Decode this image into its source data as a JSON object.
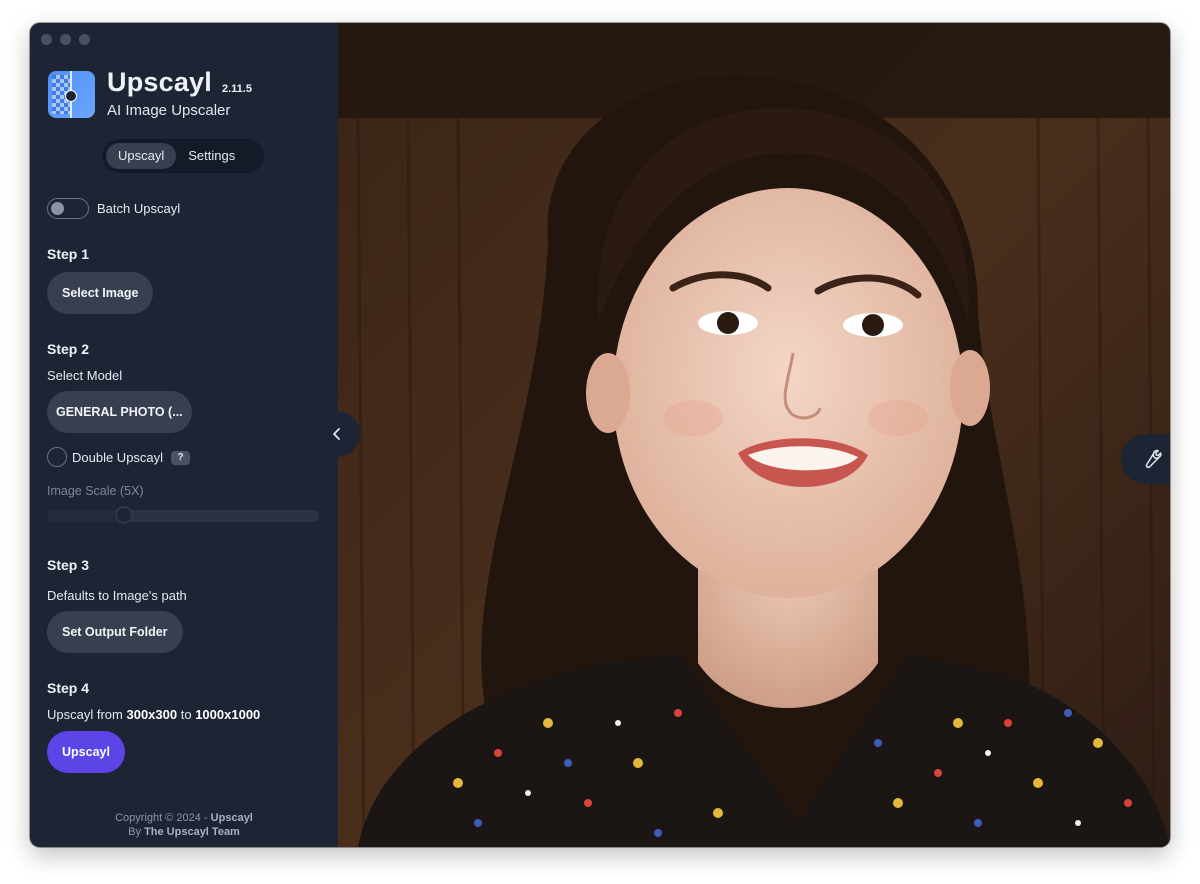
{
  "app": {
    "name": "Upscayl",
    "version": "2.11.5",
    "subtitle": "AI Image Upscaler"
  },
  "tabs": [
    {
      "label": "Upscayl",
      "active": true
    },
    {
      "label": "Settings",
      "active": false
    }
  ],
  "batch": {
    "label": "Batch Upscayl",
    "enabled": false
  },
  "step1": {
    "title": "Step 1",
    "button": "Select Image"
  },
  "step2": {
    "title": "Step 2",
    "select_model_label": "Select Model",
    "model_button": "GENERAL PHOTO (...",
    "double_upscayl_label": "Double Upscayl",
    "double_upscayl_checked": false,
    "help_badge": "?",
    "image_scale_label": "Image Scale (5X)",
    "image_scale_value": 5
  },
  "step3": {
    "title": "Step 3",
    "text": "Defaults to Image's path",
    "button": "Set Output Folder"
  },
  "step4": {
    "title": "Step 4",
    "text_prefix": "Upscayl from",
    "from_size": "300x300",
    "to_word": "to",
    "to_size": "1000x1000",
    "button": "Upscayl"
  },
  "footer": {
    "copyright_prefix": "Copyright © 2024 -",
    "copyright_name": "Upscayl",
    "by_prefix": "By",
    "by_name": "The Upscayl Team"
  },
  "icons": {
    "collapse": "chevron-left-icon",
    "tools": "wrench-icon",
    "logo": "upscayl-logo"
  },
  "colors": {
    "sidebar_bg": "#1d2535",
    "button_bg": "#38404f",
    "primary_button": "#5b45e6"
  }
}
